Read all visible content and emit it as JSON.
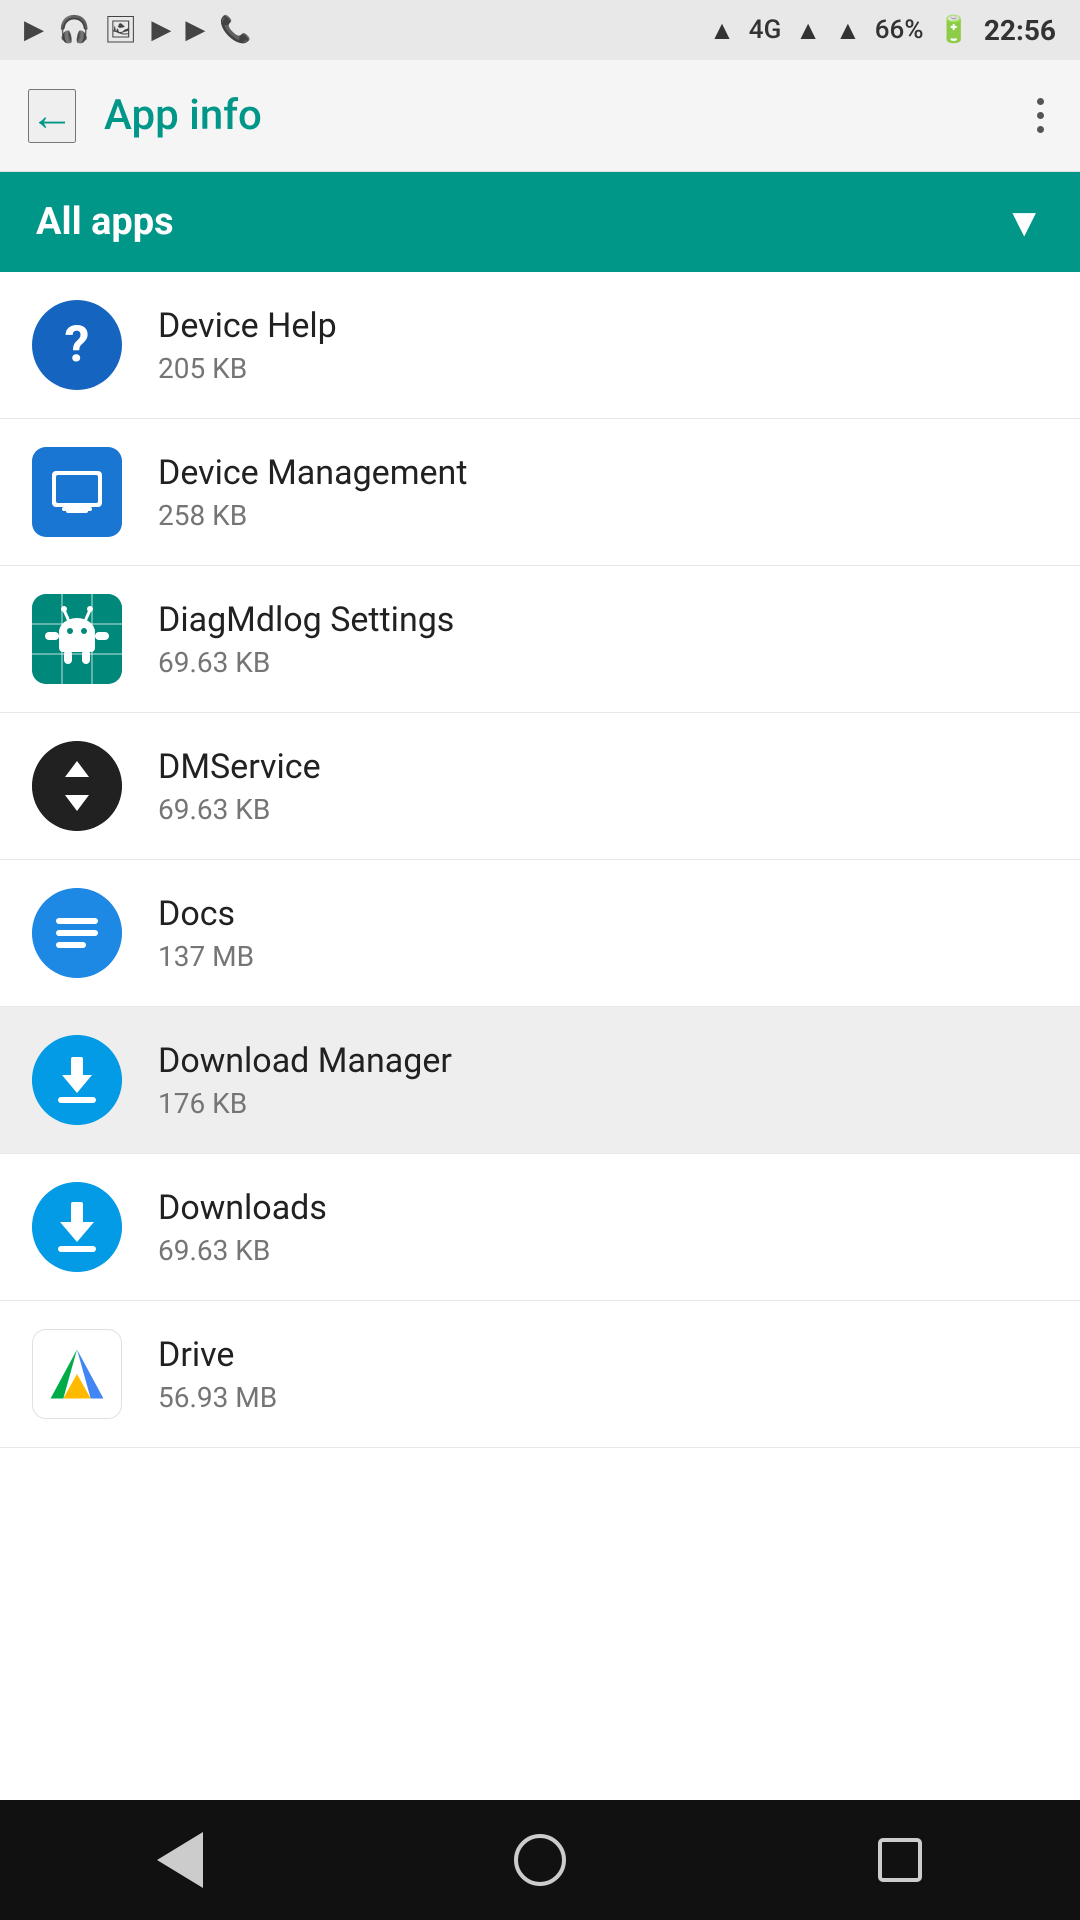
{
  "statusBar": {
    "time": "22:56",
    "battery": "66%",
    "signal": "4G",
    "icons": [
      "play",
      "headset",
      "image",
      "youtube",
      "youtube2",
      "phone",
      "bluetooth",
      "signal4g",
      "battery"
    ]
  },
  "appBar": {
    "title": "App info",
    "backIcon": "←",
    "moreIcon": "⋮"
  },
  "filterBar": {
    "label": "All apps",
    "chevronIcon": "▼"
  },
  "appList": [
    {
      "name": "Device Help",
      "size": "205 KB",
      "icon": "device-help",
      "highlighted": false
    },
    {
      "name": "Device Management",
      "size": "258 KB",
      "icon": "device-management",
      "highlighted": false
    },
    {
      "name": "DiagMdlog Settings",
      "size": "69.63 KB",
      "icon": "diagmdlog",
      "highlighted": false
    },
    {
      "name": "DMService",
      "size": "69.63 KB",
      "icon": "dmservice",
      "highlighted": false
    },
    {
      "name": "Docs",
      "size": "137 MB",
      "icon": "docs",
      "highlighted": false
    },
    {
      "name": "Download Manager",
      "size": "176 KB",
      "icon": "download-manager",
      "highlighted": true
    },
    {
      "name": "Downloads",
      "size": "69.63 KB",
      "icon": "downloads",
      "highlighted": false
    },
    {
      "name": "Drive",
      "size": "56.93 MB",
      "icon": "drive",
      "highlighted": false
    }
  ],
  "navBar": {
    "backLabel": "back",
    "homeLabel": "home",
    "recentLabel": "recent"
  }
}
